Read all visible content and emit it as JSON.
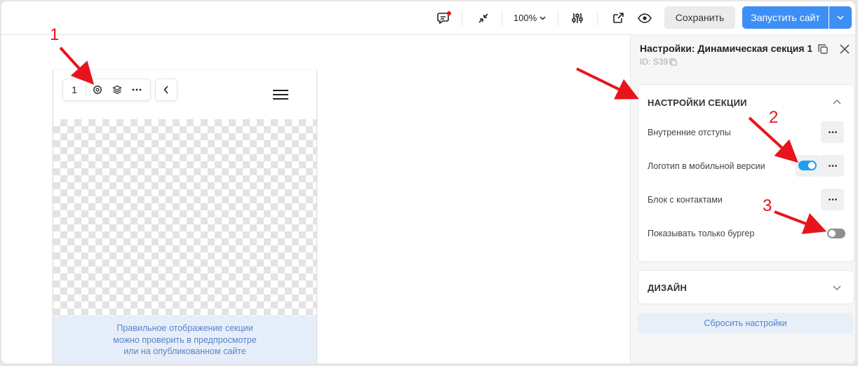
{
  "toolbar": {
    "zoom_label": "100%",
    "save_label": "Сохранить",
    "launch_label": "Запустить сайт"
  },
  "canvas": {
    "section_number": "1",
    "notice_lines": [
      "Правильное отображение секции",
      "можно проверить в предпросмотре",
      "или на опубликованном сайте"
    ]
  },
  "panel": {
    "title": "Настройки: Динамическая секция 1",
    "id_text": "ID: S39",
    "settings_card": {
      "heading": "НАСТРОЙКИ СЕКЦИИ",
      "rows": [
        {
          "label": "Внутренние отступы"
        },
        {
          "label": "Логотип в мобильной версии",
          "toggle_on": true
        },
        {
          "label": "Блок с контактами"
        },
        {
          "label": "Показывать только бургер",
          "toggle_on": false
        }
      ]
    },
    "design_card": {
      "heading": "ДИЗАЙН"
    },
    "reset_label": "Сбросить настройки"
  },
  "annotations": [
    "1",
    "2",
    "3"
  ],
  "colors": {
    "accent": "#3d8ff5",
    "toggle_on": "#1ea0ef",
    "toggle_off": "#8f8f8f",
    "annotation": "#e8141c",
    "notice_text": "#5a83c9",
    "notification_dot": "#e8141c"
  }
}
